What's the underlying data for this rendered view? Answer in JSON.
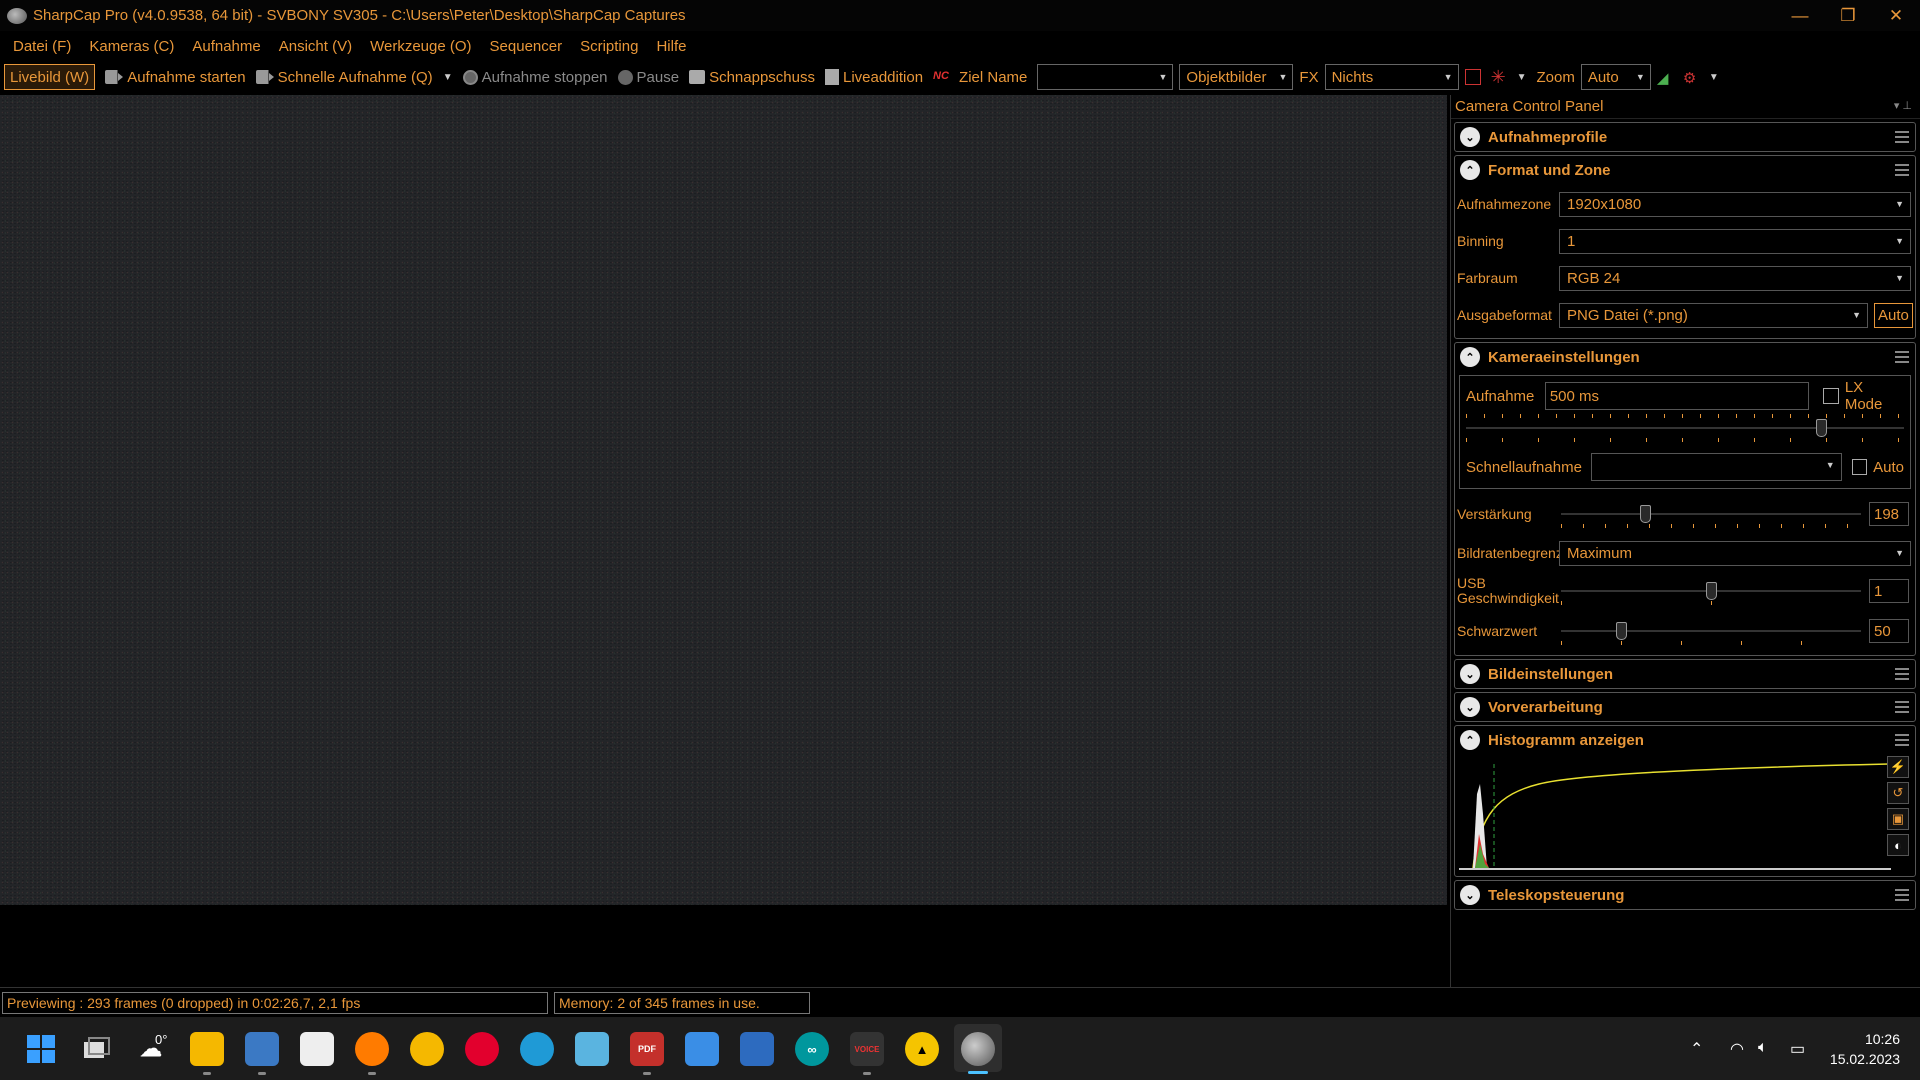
{
  "window": {
    "title": "SharpCap Pro (v4.0.9538, 64 bit) - SVBONY SV305 - C:\\Users\\Peter\\Desktop\\SharpCap Captures",
    "controls": {
      "minimize": "—",
      "restore": "❐",
      "close": "✕"
    }
  },
  "menu": [
    "Datei (F)",
    "Kameras (C)",
    "Aufnahme",
    "Ansicht (V)",
    "Werkzeuge (O)",
    "Sequencer",
    "Scripting",
    "Hilfe"
  ],
  "toolbar": {
    "live": "Livebild (W)",
    "start_capture": "Aufnahme starten",
    "quick_capture": "Schnelle Aufnahme (Q)",
    "stop_capture": "Aufnahme stoppen",
    "pause": "Pause",
    "snapshot": "Schnappschuss",
    "live_stack": "Liveaddition",
    "target_name_label": "Ziel Name",
    "target_name_value": "",
    "object_images": "Objektbilder",
    "fx_label": "FX",
    "fx_value": "Nichts",
    "zoom_label": "Zoom",
    "zoom_value": "Auto"
  },
  "panel": {
    "title": "Camera Control Panel",
    "sections": {
      "capture_profiles": "Aufnahmeprofile",
      "format_zone": "Format und Zone",
      "camera_settings": "Kameraeinstellungen",
      "image_settings": "Bildeinstellungen",
      "preprocessing": "Vorverarbeitung",
      "histogram": "Histogramm anzeigen",
      "telescope": "Teleskopsteuerung"
    },
    "format": {
      "zone_label": "Aufnahmezone",
      "zone_value": "1920x1080",
      "binning_label": "Binning",
      "binning_value": "1",
      "colorspace_label": "Farbraum",
      "colorspace_value": "RGB 24",
      "output_label": "Ausgabeformat",
      "output_value": "PNG Datei (*.png)",
      "auto_btn": "Auto"
    },
    "camera": {
      "exposure_label": "Aufnahme",
      "exposure_value": "500 ms",
      "lx_mode": "LX Mode",
      "quick_label": "Schnellaufnahme",
      "quick_value": "",
      "quick_auto": "Auto",
      "gain_label": "Verstärkung",
      "gain_value": "198",
      "framerate_label": "Bildratenbegrenzung",
      "framerate_value": "Maximum",
      "usb_label": "USB Geschwindigkeit",
      "usb_value": "1",
      "black_label": "Schwarzwert",
      "black_value": "50"
    },
    "slider_levels": {
      "exposure": 0.81,
      "gain": 0.28,
      "usb": 0.5,
      "black": 0.2
    }
  },
  "status": {
    "preview": "Previewing : 293 frames (0 dropped) in 0:02:26,7, 2,1 fps",
    "memory": "Memory: 2 of 345 frames in use."
  },
  "taskbar": {
    "temperature": "0°",
    "time": "10:26",
    "date": "15.02.2023"
  }
}
